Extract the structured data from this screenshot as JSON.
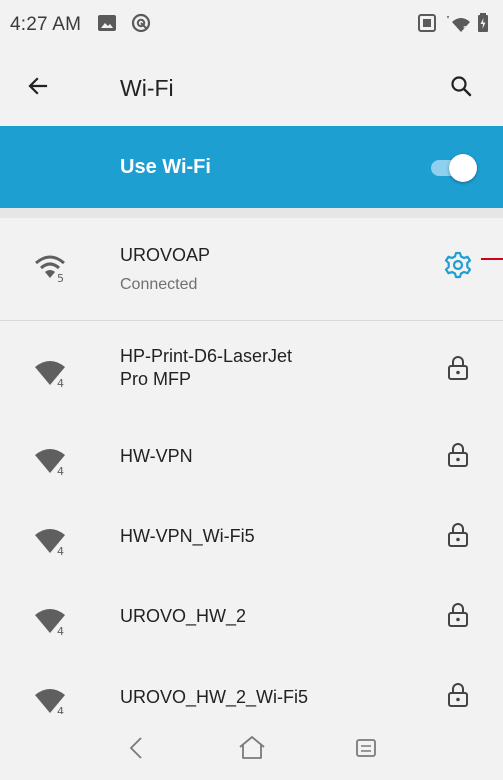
{
  "status_bar": {
    "time": "4:27 AM",
    "left_icons": [
      "image-notification-icon",
      "location-icon"
    ],
    "right_icons": [
      "screenshot-icon",
      "wifi-signal-icon",
      "battery-icon"
    ]
  },
  "app_bar": {
    "title": "Wi-Fi",
    "back_icon": "arrow-back-icon",
    "search_icon": "search-icon"
  },
  "master_switch": {
    "label": "Use Wi-Fi",
    "enabled": true
  },
  "connected_network": {
    "name": "UROVOAP",
    "status": "Connected",
    "signal_badge": "5",
    "trailing_icon": "gear-icon"
  },
  "networks": [
    {
      "name_line1": "HP-Print-D6-LaserJet",
      "name_line2": "Pro MFP",
      "signal_badge": "4",
      "secured": true
    },
    {
      "name_line1": "HW-VPN",
      "name_line2": "",
      "signal_badge": "4",
      "secured": true
    },
    {
      "name_line1": "HW-VPN_Wi-Fi5",
      "name_line2": "",
      "signal_badge": "4",
      "secured": true
    },
    {
      "name_line1": "UROVO_HW_2",
      "name_line2": "",
      "signal_badge": "4",
      "secured": true
    },
    {
      "name_line1": "UROVO_HW_2_Wi-Fi5",
      "name_line2": "",
      "signal_badge": "4",
      "secured": true
    }
  ],
  "nav_bar": {
    "back": "nav-back-icon",
    "home": "nav-home-icon",
    "menu": "nav-menu-icon"
  },
  "colors": {
    "accent": "#1e9fd2",
    "background": "#f2f2f2",
    "icon_gray": "#5f5f5f"
  }
}
